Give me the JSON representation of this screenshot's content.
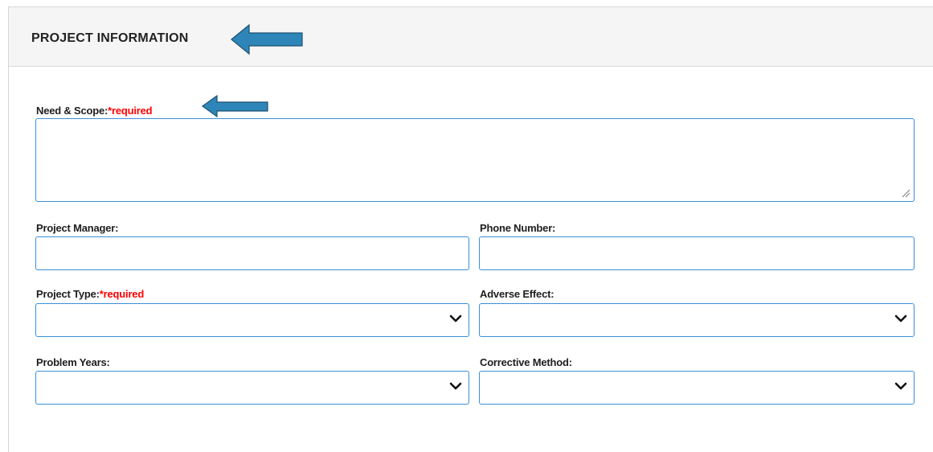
{
  "panel": {
    "title": "PROJECT INFORMATION"
  },
  "fields": {
    "need_scope": {
      "label": "Need & Scope:",
      "required": "*required",
      "value": ""
    },
    "project_manager": {
      "label": "Project Manager:",
      "value": ""
    },
    "phone_number": {
      "label": "Phone Number:",
      "value": ""
    },
    "project_type": {
      "label": "Project Type:",
      "required": "*required",
      "value": ""
    },
    "adverse_effect": {
      "label": "Adverse Effect:",
      "value": ""
    },
    "problem_years": {
      "label": "Problem Years:",
      "value": ""
    },
    "corrective_method": {
      "label": "Corrective Method:",
      "value": ""
    }
  },
  "colors": {
    "required": "#ff0000",
    "field_border": "#3a8fd6",
    "annotation_arrow": "#2e86b8"
  },
  "icons": [
    "arrow-left-icon",
    "chevron-down-icon",
    "resize-grip-icon"
  ]
}
